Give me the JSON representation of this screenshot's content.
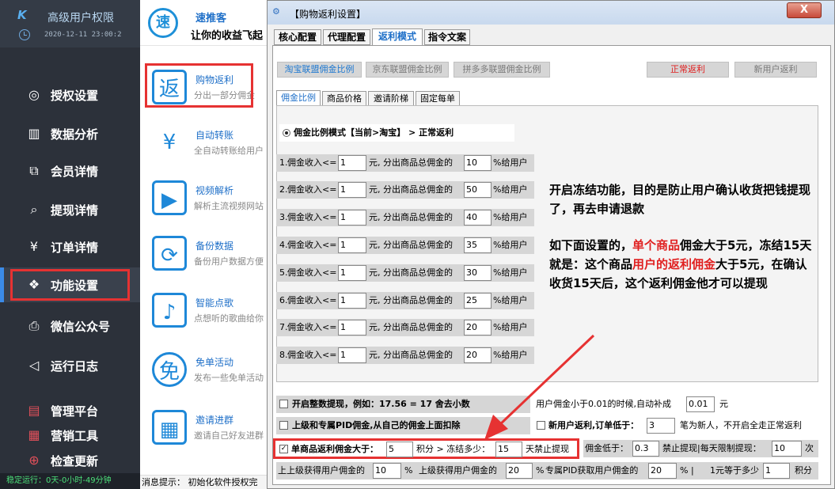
{
  "sidebar": {
    "title": "高级用户权限",
    "time": "2020-12-11 23:00:2",
    "items": [
      {
        "label": "授权设置"
      },
      {
        "label": "数据分析"
      },
      {
        "label": "会员详情"
      },
      {
        "label": "提现详情"
      },
      {
        "label": "订单详情"
      },
      {
        "label": "功能设置"
      },
      {
        "label": "微信公众号"
      },
      {
        "label": "运行日志"
      },
      {
        "label": "管理平台"
      },
      {
        "label": "营销工具"
      },
      {
        "label": "检查更新"
      }
    ],
    "status": "稳定运行：0天-0小时-49分钟"
  },
  "middle": {
    "logo_char": "速",
    "title": "速推客",
    "slogan": "让你的收益飞起",
    "features": [
      {
        "icon": "返",
        "title": "购物返利",
        "desc": "分出一部分佣金"
      },
      {
        "icon": "¥",
        "title": "自动转账",
        "desc": "全自动转账给用户"
      },
      {
        "icon": "▶",
        "title": "视频解析",
        "desc": "解析主流视频网站"
      },
      {
        "icon": "⟳",
        "title": "备份数据",
        "desc": "备份用户数据方便"
      },
      {
        "icon": "♪",
        "title": "智能点歌",
        "desc": "点想听的歌曲给你"
      },
      {
        "icon": "免",
        "title": "免单活动",
        "desc": "发布一些免单活动"
      },
      {
        "icon": "▦",
        "title": "邀请进群",
        "desc": "邀请自己好友进群"
      }
    ],
    "status": "消息提示：  初始化软件授权完"
  },
  "dialog": {
    "title": "【购物返利设置】",
    "close": "X",
    "tabs": [
      "核心配置",
      "代理配置",
      "返利模式",
      "指令文案"
    ],
    "buttons": {
      "taobao": "淘宝联盟佣金比例",
      "jd": "京东联盟佣金比例",
      "pdd": "拼多多联盟佣金比例",
      "normal": "正常返利",
      "new_user": "新用户返利"
    },
    "subtabs": [
      "佣金比例",
      "商品价格",
      "邀请阶梯",
      "固定每单"
    ],
    "mode": "佣金比例模式【当前>淘宝】 > 正常返利",
    "tiers": [
      {
        "n": "1.",
        "a": "佣金收入<=",
        "v1": "1",
        "b": "元, 分出商品总佣金的",
        "v2": "10",
        "c": "%给用户"
      },
      {
        "n": "2.",
        "a": "佣金收入<=",
        "v1": "1",
        "b": "元, 分出商品总佣金的",
        "v2": "50",
        "c": "%给用户"
      },
      {
        "n": "3.",
        "a": "佣金收入<=",
        "v1": "1",
        "b": "元, 分出商品总佣金的",
        "v2": "40",
        "c": "%给用户"
      },
      {
        "n": "4.",
        "a": "佣金收入<=",
        "v1": "1",
        "b": "元, 分出商品总佣金的",
        "v2": "35",
        "c": "%给用户"
      },
      {
        "n": "5.",
        "a": "佣金收入<=",
        "v1": "1",
        "b": "元, 分出商品总佣金的",
        "v2": "30",
        "c": "%给用户"
      },
      {
        "n": "6.",
        "a": "佣金收入<=",
        "v1": "1",
        "b": "元, 分出商品总佣金的",
        "v2": "25",
        "c": "%给用户"
      },
      {
        "n": "7.",
        "a": "佣金收入<=",
        "v1": "1",
        "b": "元, 分出商品总佣金的",
        "v2": "20",
        "c": "%给用户"
      },
      {
        "n": "8.",
        "a": "佣金收入<=",
        "v1": "1",
        "b": "元, 分出商品总佣金的",
        "v2": "20",
        "c": "%给用户"
      }
    ],
    "note": {
      "p1": "开启冻结功能，目的是防止用户确认收货把钱提现了，再去申请退款",
      "p2a": "如下面设置的，",
      "p2b": "单个商品",
      "p2c": "佣金大于5元，冻结15天",
      "p3a": "就是：这个商品",
      "p3b": "用户的返利佣金",
      "p3c": "大于5元，在确认收货15天后，这个返利佣金他才可以提现"
    },
    "options": {
      "round": "开启整数提现，例如：17.56 = 17 舍去小数",
      "pid": "上级和专属PID佣金,从自己的佣金上面扣除",
      "freeze_label": "单商品返利佣金大于：",
      "freeze_value": "5",
      "freeze_mid": "积分 > 冻结多少：",
      "freeze_days": "15",
      "freeze_end": "天禁止提现",
      "auto_label": "用户佣金小于0.01的时候,自动补成",
      "auto_value": "0.01",
      "auto_unit": "元",
      "newuser_label": "新用户返利,订单低于：",
      "newuser_value": "3",
      "newuser_end": "笔为新人，不开启全走正常返利",
      "low_label": "佣金低于：",
      "low_value": "0.3",
      "low_mid": "禁止提现|每天限制提现：",
      "low_count": "10",
      "low_end": "次",
      "b1": "上上级获得用户佣金的",
      "b1v": "10",
      "b1u": "%",
      "b2": "上级获得用户佣金的",
      "b2v": "20",
      "b2u": "%",
      "b3": "专属PID获取用户佣金的",
      "b3v": "20",
      "b3u": "%  |",
      "b4": "1元等于多少",
      "b4v": "1",
      "b4u": "积分"
    }
  }
}
